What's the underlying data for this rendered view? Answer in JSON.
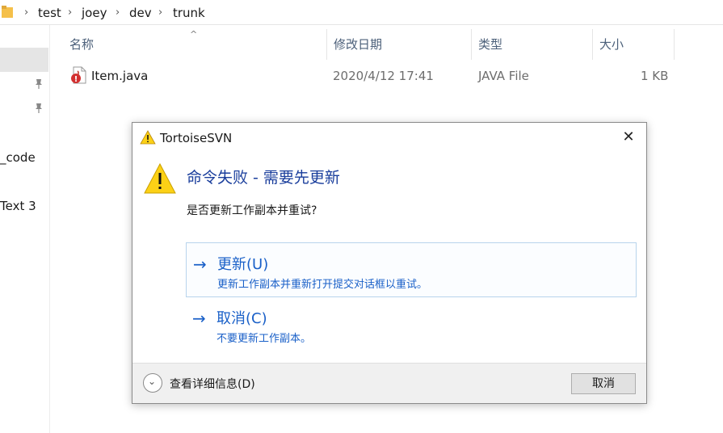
{
  "breadcrumb": [
    "test",
    "joey",
    "dev",
    "trunk"
  ],
  "nav": {
    "items": [
      {
        "label": "",
        "selected": true
      },
      {
        "label": "",
        "pinned": true
      },
      {
        "label": "",
        "pinned": true
      },
      {
        "label": "_code"
      },
      {
        "label": "Text 3"
      }
    ]
  },
  "columns": {
    "name": "名称",
    "modified": "修改日期",
    "type": "类型",
    "size": "大小"
  },
  "files": [
    {
      "name": "Item.java",
      "modified": "2020/4/12 17:41",
      "type": "JAVA File",
      "size": "1 KB",
      "icon": "svn-modified-java-icon"
    }
  ],
  "dialog": {
    "title": "TortoiseSVN",
    "main_instruction": "命令失败 - 需要先更新",
    "content": "是否更新工作副本并重试?",
    "commands": [
      {
        "label": "更新(U)",
        "note": "更新工作副本并重新打开提交对话框以重试。"
      },
      {
        "label": "取消(C)",
        "note": "不要更新工作副本。"
      }
    ],
    "details_label": "查看详细信息(D)",
    "cancel_label": "取消"
  },
  "colors": {
    "link_blue": "#1a60c8",
    "instruction_blue": "#1a3e9c",
    "warning_yellow": "#fcd116"
  }
}
